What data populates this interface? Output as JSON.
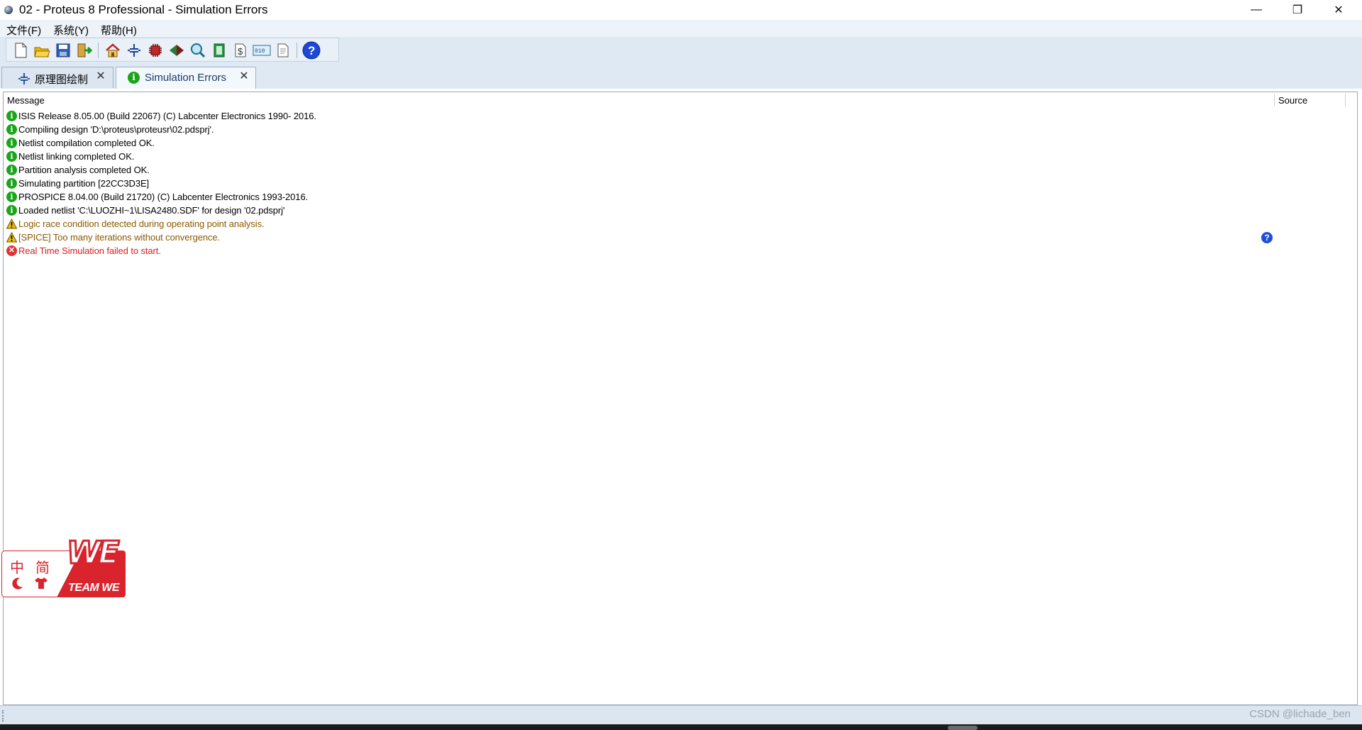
{
  "window": {
    "title": "02 - Proteus 8 Professional - Simulation Errors",
    "minimize": "—",
    "restore": "❐",
    "close": "✕"
  },
  "menu": {
    "items": [
      "文件(F)",
      "系统(Y)",
      "帮助(H)"
    ]
  },
  "toolbar": {
    "icons": [
      "new-file-icon",
      "open-folder-icon",
      "save-icon",
      "import-icon",
      "home-icon",
      "schematic-icon",
      "pcb-icon",
      "3d-viewer-icon",
      "gerber-icon",
      "bom-icon",
      "design-explorer-icon",
      "vsm-studio-icon",
      "notes-icon",
      "help-icon"
    ]
  },
  "tabs": [
    {
      "label": "原理图绘制",
      "icon": "schematic-icon",
      "active": false
    },
    {
      "label": "Simulation Errors",
      "icon": "info-icon",
      "active": true
    }
  ],
  "log": {
    "columns": [
      "Message",
      "Source"
    ],
    "rows": [
      {
        "type": "info",
        "text": "ISIS Release 8.05.00 (Build 22067) (C) Labcenter Electronics 1990- 2016."
      },
      {
        "type": "info",
        "text": "Compiling design 'D:\\proteus\\proteusr\\02.pdsprj'."
      },
      {
        "type": "info",
        "text": "Netlist compilation completed OK."
      },
      {
        "type": "info",
        "text": "Netlist linking completed OK."
      },
      {
        "type": "info",
        "text": "Partition analysis completed OK."
      },
      {
        "type": "info",
        "text": "Simulating partition [22CC3D3E]"
      },
      {
        "type": "info",
        "text": "PROSPICE 8.04.00 (Build 21720) (C) Labcenter Electronics 1993-2016."
      },
      {
        "type": "info",
        "text": "Loaded netlist 'C:\\LUOZHI~1\\LISA2480.SDF' for design '02.pdsprj'"
      },
      {
        "type": "warning",
        "text": "Logic race condition detected during operating point analysis."
      },
      {
        "type": "warning",
        "text": "[SPICE] Too many iterations without convergence."
      },
      {
        "type": "error",
        "text": "Real Time Simulation failed to start."
      }
    ],
    "colors": {
      "info": "#000000",
      "warning": "#8a5a00",
      "error": "#e01b1b"
    }
  },
  "overlay": {
    "chars": [
      "中",
      "简"
    ],
    "brand": "TEAM WE",
    "logo": "WE"
  },
  "statusbar": {
    "watermark": "CSDN @lichade_ben"
  }
}
